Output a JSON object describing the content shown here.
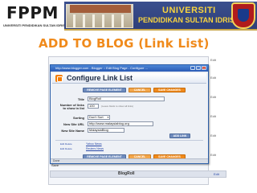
{
  "header": {
    "logo_text": "FPPM",
    "logo_subtitle": "UNIVERSITI PENDIDIKAN SULTAN IDRIS",
    "banner_title": "UNIVERSITI",
    "banner_subtitle": "PENDIDIKAN SULTAN IDRIS"
  },
  "slide": {
    "title": "ADD TO BLOG (Link List)"
  },
  "browser": {
    "window_title": "http://www.blogger.com - Blogger :: Edit Blog Page - Configure ...",
    "dialog_title": "Configure Link List"
  },
  "buttons": {
    "remove": "REMOVE PAGE ELEMENT",
    "cancel": "CANCEL",
    "save": "SAVE CHANGES",
    "add_link": "ADD LINK"
  },
  "form": {
    "title_label": "Title",
    "title_value": "BlogRoll",
    "count_label": "Number of links to show in list",
    "count_value": "100",
    "count_note": "(Leave blank to show all links)",
    "sorting_label": "Sorting",
    "sorting_value": "Don't Sort",
    "url_label": "New Site URL",
    "url_value": "http://www.malaysiablog.org",
    "name_label": "New Site Name",
    "name_value": "MalaysiaBlog"
  },
  "links": [
    {
      "actions": "Edit  Delete",
      "name": "Yahoo News"
    },
    {
      "actions": "Edit  Delete",
      "name": "Reuters News"
    }
  ],
  "background": {
    "right_items": [
      "Edit",
      "Edit",
      "Edit",
      "Edit",
      "Edit",
      "Edit",
      "Edit"
    ],
    "save_label": "Save",
    "bottom_bar_label": "BlogRoll",
    "bottom_edit": "Edit"
  },
  "status_bar": "Done"
}
